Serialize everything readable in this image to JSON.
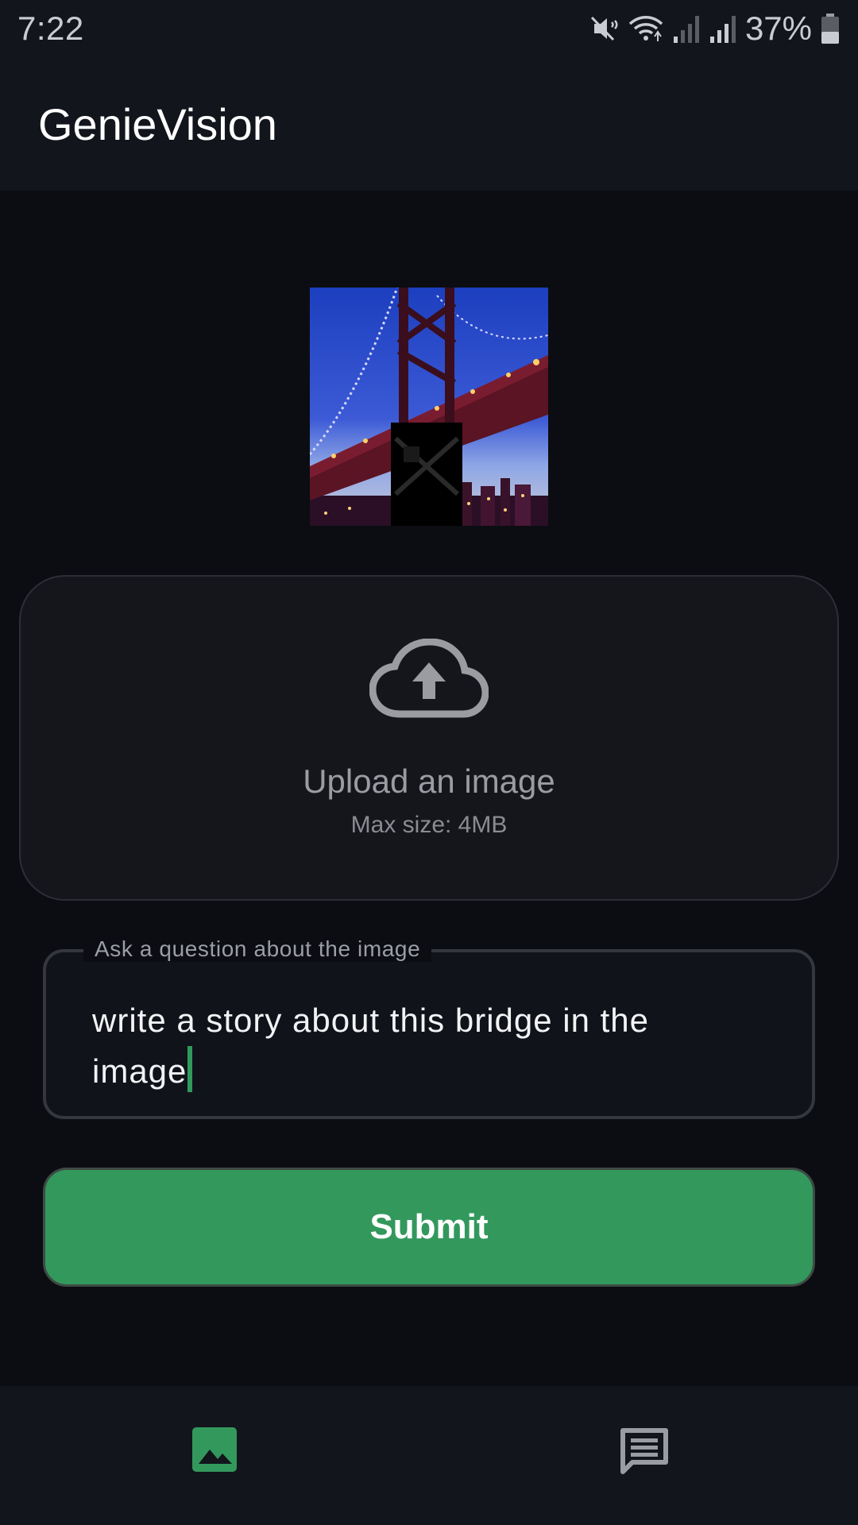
{
  "status_bar": {
    "time": "7:22",
    "battery": "37%",
    "icons": [
      "mute-icon",
      "wifi-icon",
      "signal-icon",
      "signal-icon",
      "battery-icon"
    ]
  },
  "app_bar": {
    "title": "GenieVision"
  },
  "preview": {
    "description_icon": "image-preview"
  },
  "upload": {
    "icon": "cloud-upload-icon",
    "title": "Upload an image",
    "subtitle": "Max size: 4MB"
  },
  "question": {
    "label": "Ask a question about the image",
    "value": "write a story about this bridge in the image"
  },
  "submit": {
    "label": "Submit"
  },
  "bottom_nav": {
    "items": [
      {
        "icon": "image-icon",
        "active": true,
        "color": "#33985c"
      },
      {
        "icon": "chat-icon",
        "active": false,
        "color": "#9a9ca2"
      }
    ]
  },
  "colors": {
    "accent": "#33985c",
    "background": "#0b0d12",
    "surface": "#12151c"
  }
}
